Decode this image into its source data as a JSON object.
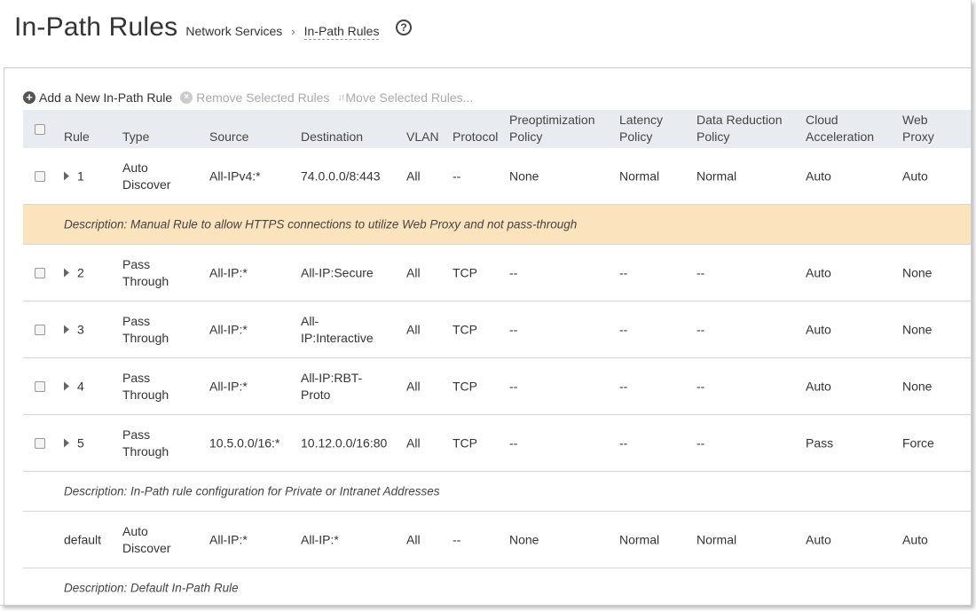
{
  "header": {
    "title": "In-Path Rules",
    "breadcrumb": [
      "Network Services",
      "In-Path Rules"
    ],
    "breadcrumb_separator": "›",
    "help_icon": "?"
  },
  "toolbar": {
    "add_label": "Add a New In-Path Rule",
    "remove_label": "Remove Selected Rules",
    "move_label": "Move Selected Rules...",
    "add_icon": "+",
    "remove_icon": "×",
    "move_icon": "↓↑"
  },
  "columns": {
    "rule": "Rule",
    "type": "Type",
    "source": "Source",
    "destination": "Destination",
    "vlan": "VLAN",
    "protocol": "Protocol",
    "preopt_1": "Preoptimization",
    "preopt_2": "Policy",
    "latency_1": "Latency",
    "latency_2": "Policy",
    "dr_1": "Data Reduction",
    "dr_2": "Policy",
    "ca_1": "Cloud",
    "ca_2": "Acceleration",
    "wp_1": "Web",
    "wp_2": "Proxy"
  },
  "rules": [
    {
      "rule": "1",
      "type_1": "Auto",
      "type_2": "Discover",
      "source": "All-IPv4:*",
      "dest_1": "74.0.0.0/8:443",
      "dest_2": "",
      "vlan": "All",
      "protocol": "--",
      "preopt": "None",
      "latency": "Normal",
      "dr": "Normal",
      "ca": "Auto",
      "wp": "Auto",
      "description": "Description: Manual Rule to allow HTTPS connections to utilize Web Proxy and not pass-through"
    },
    {
      "rule": "2",
      "type_1": "Pass",
      "type_2": "Through",
      "source": "All-IP:*",
      "dest_1": "All-IP:Secure",
      "dest_2": "",
      "vlan": "All",
      "protocol": "TCP",
      "preopt": "--",
      "latency": "--",
      "dr": "--",
      "ca": "Auto",
      "wp": "None"
    },
    {
      "rule": "3",
      "type_1": "Pass",
      "type_2": "Through",
      "source": "All-IP:*",
      "dest_1": "All-",
      "dest_2": "IP:Interactive",
      "vlan": "All",
      "protocol": "TCP",
      "preopt": "--",
      "latency": "--",
      "dr": "--",
      "ca": "Auto",
      "wp": "None"
    },
    {
      "rule": "4",
      "type_1": "Pass",
      "type_2": "Through",
      "source": "All-IP:*",
      "dest_1": "All-IP:RBT-",
      "dest_2": "Proto",
      "vlan": "All",
      "protocol": "TCP",
      "preopt": "--",
      "latency": "--",
      "dr": "--",
      "ca": "Auto",
      "wp": "None"
    },
    {
      "rule": "5",
      "type_1": "Pass",
      "type_2": "Through",
      "source": "10.5.0.0/16:*",
      "dest_1": "10.12.0.0/16:80",
      "dest_2": "",
      "vlan": "All",
      "protocol": "TCP",
      "preopt": "--",
      "latency": "--",
      "dr": "--",
      "ca": "Pass",
      "wp": "Force",
      "description": "Description: In-Path rule configuration for Private or Intranet Addresses"
    },
    {
      "rule": "default",
      "type_1": "Auto",
      "type_2": "Discover",
      "source": "All-IP:*",
      "dest_1": "All-IP:*",
      "dest_2": "",
      "vlan": "All",
      "protocol": "--",
      "preopt": "None",
      "latency": "Normal",
      "dr": "Normal",
      "ca": "Auto",
      "wp": "Auto",
      "description": "Description: Default In-Path Rule"
    }
  ],
  "colors": {
    "header_bg": "#e8ecf0",
    "highlight_bg": "#fbe3bd",
    "text": "#333333"
  }
}
